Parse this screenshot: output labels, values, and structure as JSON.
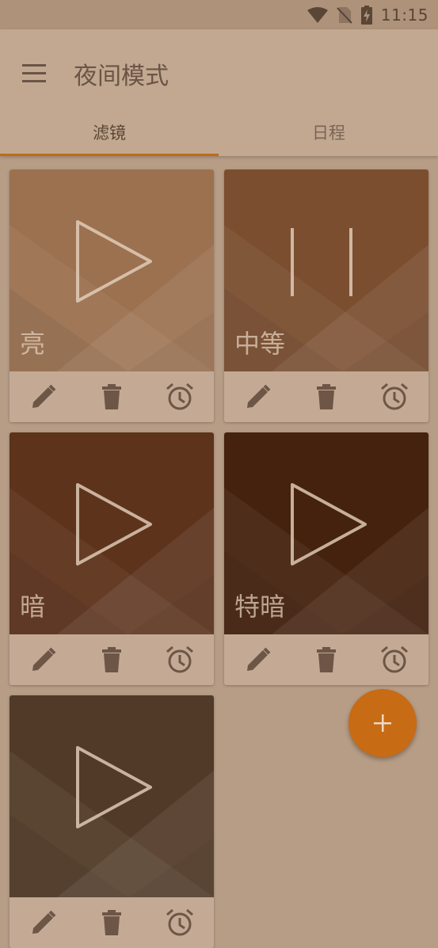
{
  "status_bar": {
    "time": "11:15"
  },
  "app_bar": {
    "title": "夜间模式"
  },
  "tabs": [
    {
      "label": "滤镜",
      "selected": true
    },
    {
      "label": "日程",
      "selected": false
    }
  ],
  "profiles": [
    {
      "name": "亮",
      "color": "#9b7150",
      "state": "play"
    },
    {
      "name": "中等",
      "color": "#7b4e30",
      "state": "pause"
    },
    {
      "name": "暗",
      "color": "#5d331c",
      "state": "play"
    },
    {
      "name": "特暗",
      "color": "#45220e",
      "state": "play"
    },
    {
      "name": "",
      "color": "#523a28",
      "state": "play"
    }
  ],
  "colors": {
    "accent": "#c76b15",
    "icon": "#6d5646"
  }
}
